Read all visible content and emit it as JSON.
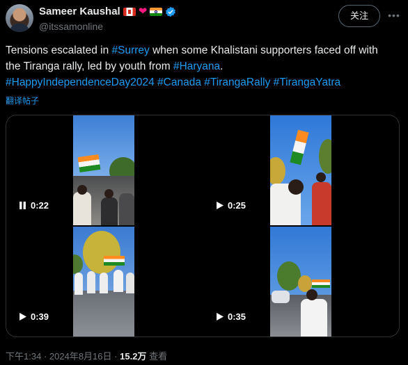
{
  "author": {
    "name": "Sameer Kaushal",
    "handle": "@itssamonline",
    "badges": [
      "canada-flag-icon",
      "heart-icon",
      "india-flag-icon",
      "verified-icon"
    ]
  },
  "follow_label": "关注",
  "tweet": {
    "part1": "Tensions escalated in ",
    "tag_surrey": "#Surrey",
    "part2": " when some Khalistani supporters faced off with the Tiranga rally, led by youth from ",
    "tag_haryana": "#Haryana",
    "part3": ".",
    "hashtags": [
      "#HappyIndependenceDay2024",
      "#Canada",
      "#TirangaRally",
      "#TirangaYatra"
    ]
  },
  "translate_label": "翻译帖子",
  "videos": [
    {
      "state": "pause-icon",
      "duration": "0:22"
    },
    {
      "state": "play-icon",
      "duration": "0:25"
    },
    {
      "state": "play-icon",
      "duration": "0:39"
    },
    {
      "state": "play-icon",
      "duration": "0:35"
    }
  ],
  "meta": {
    "time": "下午1:34",
    "date": "2024年8月16日",
    "views": "15.2万",
    "views_label": "查看"
  },
  "colors": {
    "accent": "#1d9bf0",
    "background": "#000000",
    "text": "#e7e9ea",
    "muted": "#71767b"
  }
}
